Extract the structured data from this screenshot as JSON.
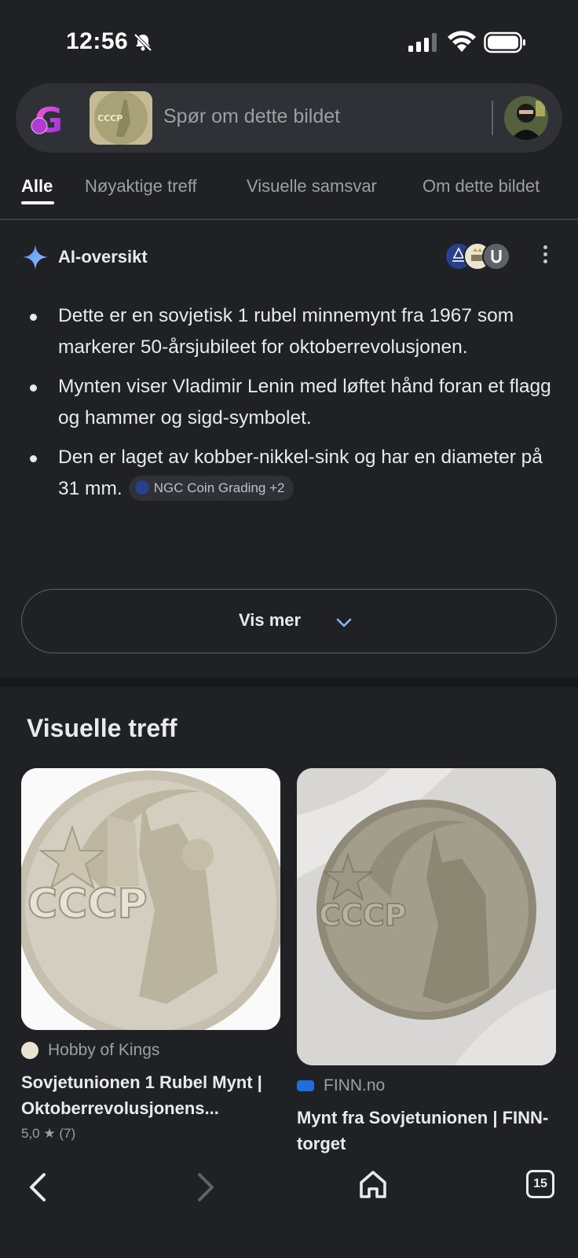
{
  "status_bar": {
    "time": "12:56"
  },
  "search": {
    "placeholder": "Spør om dette bildet"
  },
  "tabs": [
    {
      "label": "Alle",
      "active": true
    },
    {
      "label": "Nøyaktige treff"
    },
    {
      "label": "Visuelle samsvar"
    },
    {
      "label": "Om dette bildet"
    }
  ],
  "ai_overview": {
    "title": "AI-oversikt",
    "bullets": [
      "Dette er en sovjetisk 1 rubel minnemynt fra 1967 som markerer 50-årsjubileet for oktoberrevolusjonen.",
      "Mynten viser Vladimir Lenin med løftet hånd foran et flagg og hammer og sigd-symbolet.",
      "Den er laget av kobber-nikkel-sink og har en diameter på 31 mm."
    ],
    "citation": "NGC Coin Grading +2",
    "more_button": "Vis mer"
  },
  "visual_matches": {
    "title": "Visuelle treff",
    "cards": [
      {
        "source": "Hobby of Kings",
        "title": "Sovjetunionen 1 Rubel Mynt | Oktoberrevolusjonens...",
        "rating": "5,0",
        "rating_count": "(7)"
      },
      {
        "source": "FINN.no",
        "title": "Mynt fra Sovjetunionen | FINN-torget"
      }
    ]
  },
  "coin_text": "CCCP",
  "bottom_nav": {
    "tab_count": "15"
  },
  "colors": {
    "background": "#1f2125",
    "accent_blue": "#8ab4f8",
    "text": "#e8eaed",
    "muted": "#9aa0a6"
  }
}
